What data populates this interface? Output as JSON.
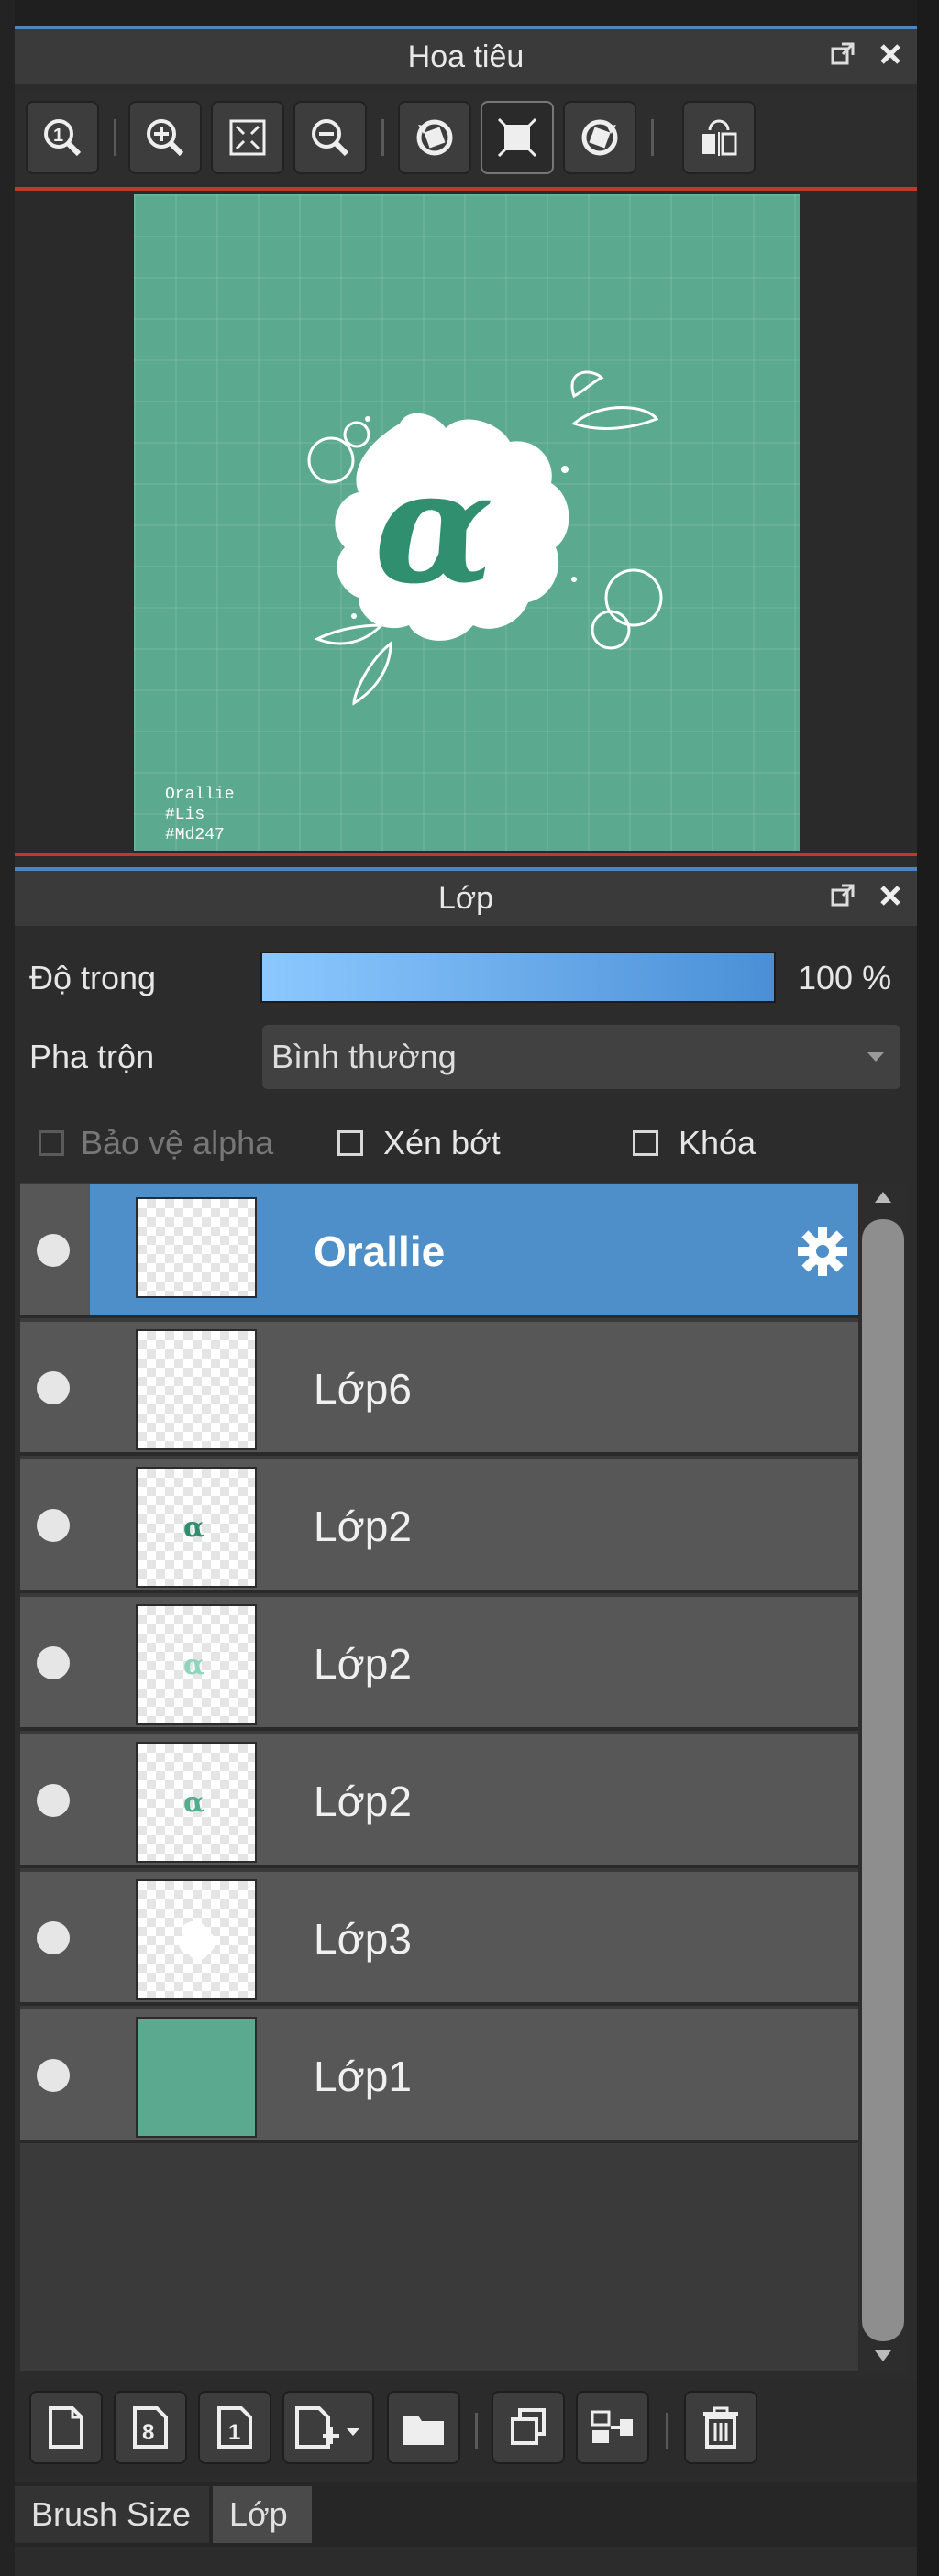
{
  "navigator": {
    "title": "Hoa tiêu",
    "toolbar": [
      {
        "name": "zoom-actual-size-icon"
      },
      {
        "name": "zoom-in-icon"
      },
      {
        "name": "fit-to-window-icon"
      },
      {
        "name": "zoom-out-icon"
      },
      {
        "name": "rotate-left-icon"
      },
      {
        "name": "fit-canvas-icon"
      },
      {
        "name": "rotate-right-icon"
      },
      {
        "name": "flip-horizontal-icon"
      }
    ],
    "preview_text": [
      "Orallie",
      "#Lis",
      "#Md247"
    ],
    "canvas_color": "#5ba98f"
  },
  "layers_panel": {
    "title": "Lớp",
    "opacity_label": "Độ trong",
    "opacity_value": "100 %",
    "opacity_percent": 100,
    "blend_label": "Pha trộn",
    "blend_value": "Bình thường",
    "protect_alpha_label": "Bảo vệ alpha",
    "clip_label": "Xén bớt",
    "lock_label": "Khóa",
    "layers": [
      {
        "name": "Orallie",
        "selected": true
      },
      {
        "name": "Lớp6",
        "selected": false
      },
      {
        "name": "Lớp2",
        "selected": false
      },
      {
        "name": "Lớp2",
        "selected": false
      },
      {
        "name": "Lớp2",
        "selected": false
      },
      {
        "name": "Lớp3",
        "selected": false
      },
      {
        "name": "Lớp1",
        "selected": false
      }
    ],
    "bottom_tools": [
      {
        "name": "new-layer-icon"
      },
      {
        "name": "new-8bit-layer-icon"
      },
      {
        "name": "new-1bit-layer-icon"
      },
      {
        "name": "add-layer-menu-icon"
      },
      {
        "name": "new-folder-icon"
      },
      {
        "name": "duplicate-layer-icon"
      },
      {
        "name": "merge-down-icon"
      },
      {
        "name": "delete-layer-icon"
      }
    ]
  },
  "tabs": {
    "brush_size": "Brush Size",
    "layer": "Lớp"
  },
  "colors": {
    "accent": "#4e8fca",
    "canvas": "#5ba98f",
    "warning_line": "#c0392b"
  }
}
